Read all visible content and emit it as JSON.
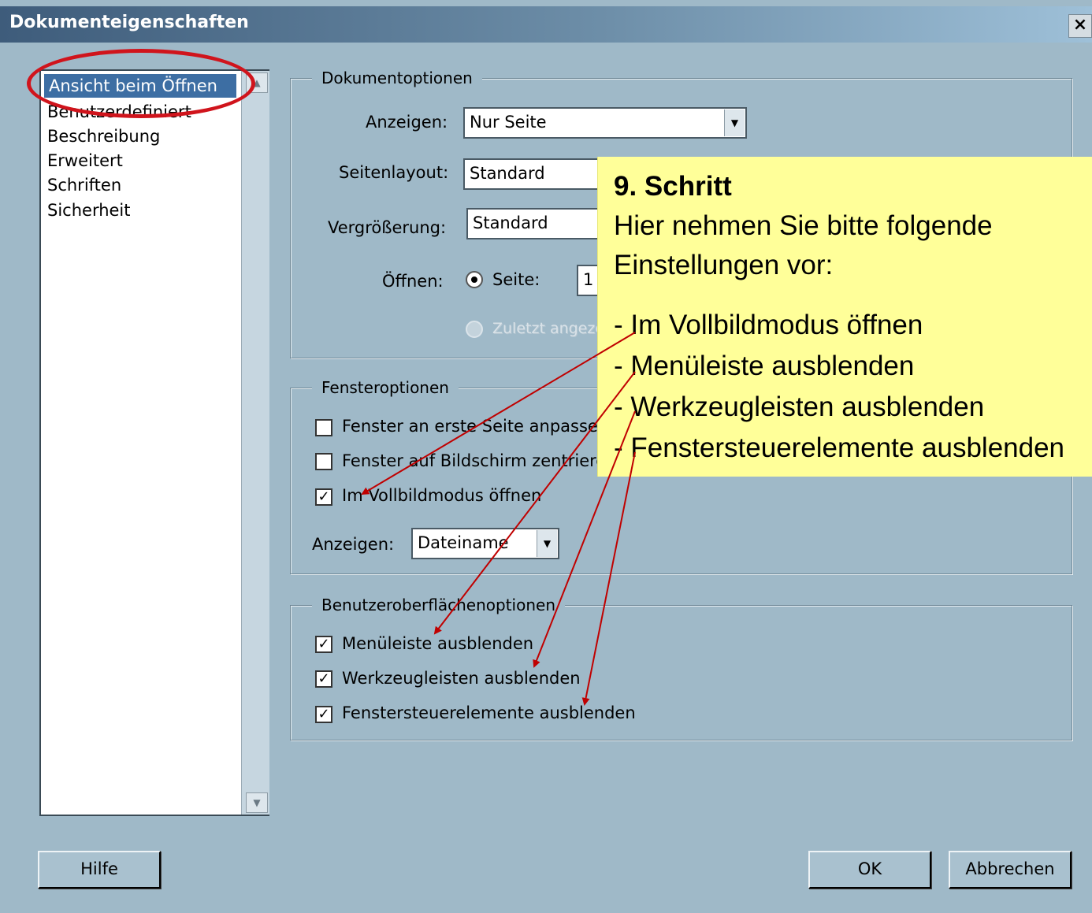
{
  "window": {
    "title": "Dokumenteigenschaften",
    "close_label": "×"
  },
  "nav": {
    "items": [
      {
        "label": "Ansicht beim Öffnen",
        "selected": true
      },
      {
        "label": "Benutzerdefiniert"
      },
      {
        "label": "Beschreibung"
      },
      {
        "label": "Erweitert"
      },
      {
        "label": "Schriften"
      },
      {
        "label": "Sicherheit"
      }
    ]
  },
  "doc_options": {
    "title": "Dokumentoptionen",
    "show_label": "Anzeigen:",
    "show_value": "Nur Seite",
    "layout_label": "Seitenlayout:",
    "layout_value": "Standard",
    "zoom_label": "Vergrößerung:",
    "zoom_value": "Standard",
    "open_label": "Öffnen:",
    "page_radio_label": "Seite:",
    "page_value": "1",
    "last_viewed_label": "Zuletzt angezeigte Seite"
  },
  "window_options": {
    "title": "Fensteroptionen",
    "fit_first_page": {
      "label": "Fenster an erste Seite anpassen",
      "checked": false
    },
    "center_screen": {
      "label": "Fenster auf Bildschirm zentrieren",
      "checked": false
    },
    "full_screen": {
      "label": "Im Vollbildmodus öffnen",
      "checked": true
    },
    "show_label": "Anzeigen:",
    "show_value": "Dateiname"
  },
  "ui_options": {
    "title": "Benutzeroberflächenoptionen",
    "hide_menubar": {
      "label": "Menüleiste ausblenden",
      "checked": true
    },
    "hide_toolbars": {
      "label": "Werkzeugleisten ausblenden",
      "checked": true
    },
    "hide_window_controls": {
      "label": "Fenstersteuerelemente ausblenden",
      "checked": true
    }
  },
  "buttons": {
    "help": "Hilfe",
    "ok": "OK",
    "cancel": "Abbrechen"
  },
  "callout": {
    "title": "9. Schritt",
    "line1": "Hier nehmen Sie bitte folgende",
    "line2": "Einstellungen vor:",
    "item1": "- Im Vollbildmodus öffnen",
    "item2": "- Menüleiste ausblenden",
    "item3": "- Werkzeugleisten ausblenden",
    "item4": "- Fenstersteuerelemente ausblenden"
  },
  "colors": {
    "dialog_bg": "#9fb9c8",
    "selection": "#3d6ea3",
    "callout_bg": "#ffff99",
    "annotation_red": "#d0141c"
  },
  "icons": {
    "close": "close-icon",
    "dropdown": "chevron-down-icon",
    "scroll_up": "scroll-up-icon",
    "scroll_down": "scroll-down-icon",
    "checkmark": "check-icon"
  }
}
